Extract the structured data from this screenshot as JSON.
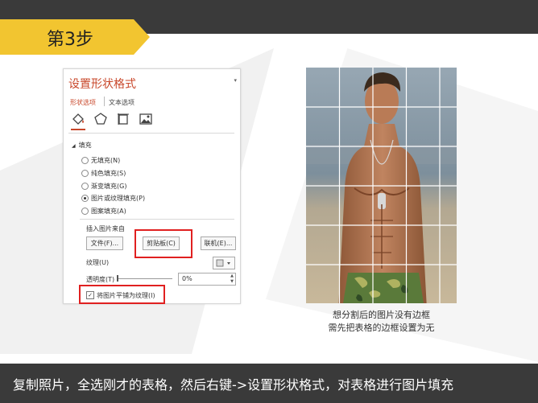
{
  "step_title": "第3步",
  "panel": {
    "title": "设置形状格式",
    "menu_glyph": "▾",
    "tabs": [
      "形状选项",
      "文本选项"
    ],
    "icons": [
      "fill-line-icon",
      "effects-pentagon-icon",
      "size-properties-icon",
      "picture-icon"
    ],
    "section_arrow": "◢",
    "section_title": "填充",
    "fill_options": [
      {
        "label": "无填充(N)",
        "selected": false
      },
      {
        "label": "纯色填充(S)",
        "selected": false
      },
      {
        "label": "渐变填充(G)",
        "selected": false
      },
      {
        "label": "图片或纹理填充(P)",
        "selected": true
      },
      {
        "label": "图案填充(A)",
        "selected": false
      }
    ],
    "insert_from_label": "插入图片来自",
    "file_button": "文件(F)...",
    "clipboard_button": "剪贴板(C)",
    "online_button": "联机(E)...",
    "texture_label": "纹理(U)",
    "transparency_label": "透明度(T)",
    "transparency_value": "0%",
    "spin_up": "▲",
    "spin_down": "▼",
    "tile_checkbox_label": "将图片平铺为纹理(I)",
    "tile_checked": true,
    "check_glyph": "✓"
  },
  "caption": {
    "line1": "想分割后的图片没有边框",
    "line2": "需先把表格的边框设置为无"
  },
  "bottom_text": "复制照片，全选刚才的表格，然后右键->设置形状格式，对表格进行图片填充",
  "colors": {
    "accent_red": "#c8472a",
    "highlight_red": "#e02020",
    "step_yellow": "#f2c530",
    "dark_bar": "#3a3a3a"
  }
}
